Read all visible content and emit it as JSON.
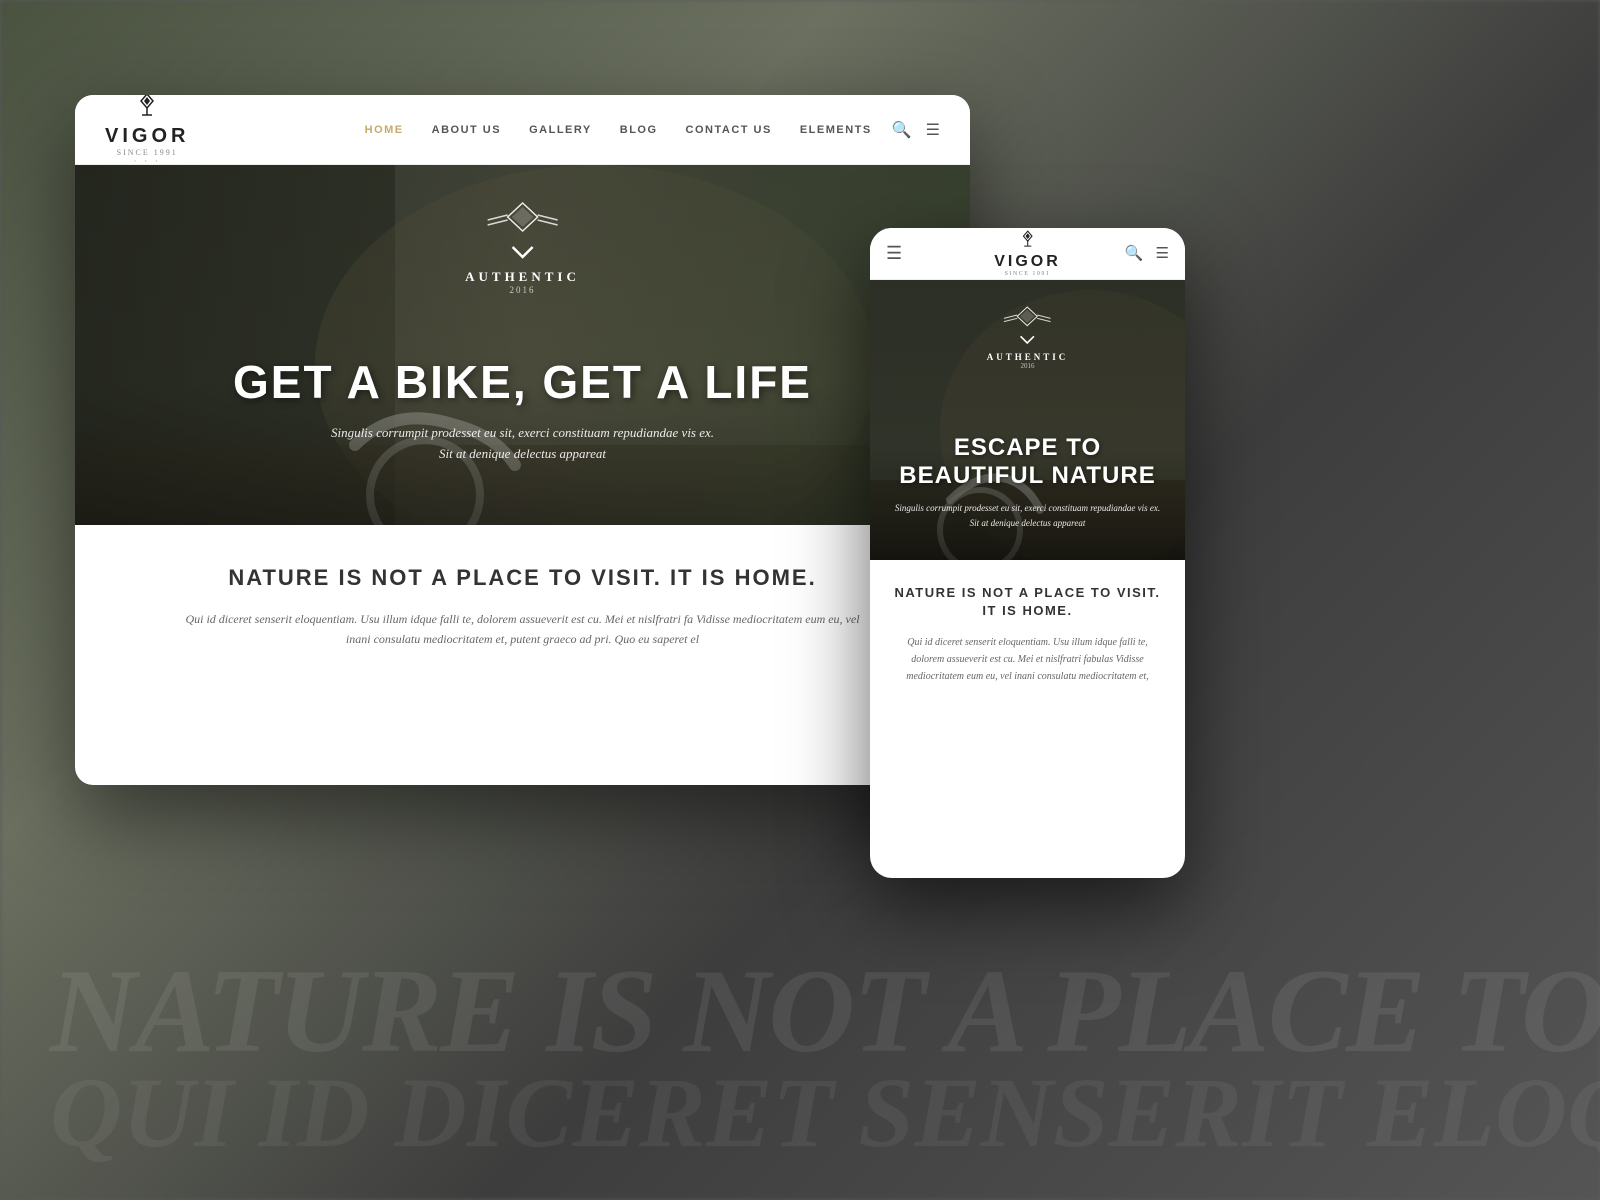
{
  "background": {
    "text1": "NATURE IS NOT A PLACE TO VISIT. IT IS HOME.",
    "text2": "Qui id diceret senserit eloquentiam. Usu illum idque falli te, dolorem assueverit est cu. Mei et nislfratri fa..."
  },
  "desktop": {
    "nav": {
      "logo": "VIGOR",
      "logo_icon": "⬡",
      "logo_subtitle": "SINCE 1991",
      "logo_dots": "· · ·",
      "links": [
        {
          "label": "HOME",
          "active": true
        },
        {
          "label": "ABOUT US",
          "active": false
        },
        {
          "label": "GALLERY",
          "active": false
        },
        {
          "label": "BLOG",
          "active": false
        },
        {
          "label": "CONTACT US",
          "active": false
        },
        {
          "label": "ELEMENTS",
          "active": false
        }
      ]
    },
    "hero": {
      "badge_label": "AUTHENTIC",
      "badge_year": "2016",
      "title": "GET A BIKE, GET A LIFE",
      "subtitle_line1": "Singulis corrumpit prodesset eu sit, exerci constituam repudiandae vis ex.",
      "subtitle_line2": "Sit at denique delectus appareat"
    },
    "content": {
      "title": "NATURE IS NOT A PLACE TO VISIT. IT IS HOME.",
      "text": "Qui id diceret senserit eloquentiam. Usu illum idque falli te, dolorem assueverit est cu. Mei et nislfratri fa Vidisse mediocritatem eum eu, vel inani consulatu mediocritatem et, putent graeco ad pri. Quo eu saperet el"
    }
  },
  "mobile": {
    "nav": {
      "logo": "VIGOR",
      "logo_icon": "⬡",
      "logo_subtitle": "SINCE 1991"
    },
    "hero": {
      "badge_label": "AUTHENTIC",
      "badge_year": "2016",
      "title": "ESCAPE TO BEAUTIFUL NATURE",
      "subtitle_line1": "Singulis corrumpit prodesset eu sit, exerci constituam repudiandae vis ex.",
      "subtitle_line2": "Sit at denique delectus appareat"
    },
    "content": {
      "title": "NATURE IS NOT A PLACE TO VISIT. IT IS HOME.",
      "text": "Qui id diceret senserit eloquentiam. Usu illum idque falli te, dolorem assueverit est cu. Mei et nislfratri fabulas Vidisse mediocritatem eum eu, vel inani consulatu mediocritatem et,"
    }
  }
}
